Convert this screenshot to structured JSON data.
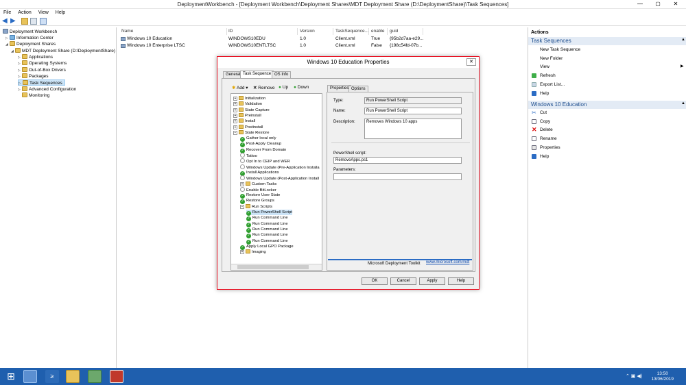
{
  "window": {
    "title": "DeploymentWorkbench - [Deployment Workbench\\Deployment Shares\\MDT Deployment Share (D:\\DeploymentShare)\\Task Sequences]",
    "minimize": "—",
    "maximize": "▢",
    "close": "✕"
  },
  "menu": [
    "File",
    "Action",
    "View",
    "Help"
  ],
  "tree": {
    "items": [
      {
        "label": "Deployment Workbench"
      },
      {
        "label": "Information Center"
      },
      {
        "label": "Deployment Shares"
      },
      {
        "label": "MDT Deployment Share (D:\\DeploymentShare)"
      },
      {
        "label": "Applications"
      },
      {
        "label": "Operating Systems"
      },
      {
        "label": "Out-of-Box Drivers"
      },
      {
        "label": "Packages"
      },
      {
        "label": "Task Sequences"
      },
      {
        "label": "Advanced Configuration"
      },
      {
        "label": "Monitoring"
      }
    ]
  },
  "list": {
    "columns": [
      "Name",
      "ID",
      "Version",
      "TaskSequence...",
      "enable",
      "guid"
    ],
    "rows": [
      [
        "Windows 10 Education",
        "WINDOWS10EDU",
        "1.0",
        "Client.xml",
        "True",
        "{95b2d7aa-e29..."
      ],
      [
        "Windows 10 Enterprise LTSC",
        "WINDOWS10ENTLTSC",
        "1.0",
        "Client.xml",
        "False",
        "{198c54fd-07b..."
      ]
    ]
  },
  "actions": {
    "header": "Actions",
    "section1": {
      "title": "Task Sequences",
      "items": [
        "New Task Sequence",
        "New Folder",
        "View",
        "Refresh",
        "Export List...",
        "Help"
      ]
    },
    "section2": {
      "title": "Windows 10 Education",
      "items": [
        "Cut",
        "Copy",
        "Delete",
        "Rename",
        "Properties",
        "Help"
      ]
    }
  },
  "dialog": {
    "title": "Windows 10 Education Properties",
    "tabs": [
      "General",
      "Task Sequence",
      "OS Info"
    ],
    "toolbar": {
      "add": "Add",
      "remove": "Remove",
      "up": "Up",
      "down": "Down"
    },
    "steps": [
      {
        "label": "Initialization",
        "kind": "group",
        "level": 0
      },
      {
        "label": "Validation",
        "kind": "group",
        "level": 0
      },
      {
        "label": "State Capture",
        "kind": "group",
        "level": 0
      },
      {
        "label": "Preinstall",
        "kind": "group",
        "level": 0
      },
      {
        "label": "Install",
        "kind": "group",
        "level": 0
      },
      {
        "label": "Postinstall",
        "kind": "group",
        "level": 0
      },
      {
        "label": "State Restore",
        "kind": "group",
        "level": 0
      },
      {
        "label": "Gather local only",
        "kind": "ok",
        "level": 1
      },
      {
        "label": "Post-Apply Cleanup",
        "kind": "ok",
        "level": 1
      },
      {
        "label": "Recover From Domain",
        "kind": "ok",
        "level": 1
      },
      {
        "label": "Tattoo",
        "kind": "dis",
        "level": 1
      },
      {
        "label": "Opt In to CEIP and WER",
        "kind": "dis",
        "level": 1
      },
      {
        "label": "Windows Update (Pre-Application Installa",
        "kind": "dis",
        "level": 1
      },
      {
        "label": "Install Applications",
        "kind": "ok",
        "level": 1
      },
      {
        "label": "Windows Update (Post-Application Install",
        "kind": "dis",
        "level": 1
      },
      {
        "label": "Custom Tasks",
        "kind": "group",
        "level": 1
      },
      {
        "label": "Enable BitLocker",
        "kind": "dis",
        "level": 1
      },
      {
        "label": "Restore User State",
        "kind": "ok",
        "level": 1
      },
      {
        "label": "Restore Groups",
        "kind": "ok",
        "level": 1
      },
      {
        "label": "Run Scripts",
        "kind": "group",
        "level": 1
      },
      {
        "label": "Run PowerShell Script",
        "kind": "ok",
        "level": 2
      },
      {
        "label": "Run Command Line",
        "kind": "ok",
        "level": 2
      },
      {
        "label": "Run Command Line",
        "kind": "ok",
        "level": 2
      },
      {
        "label": "Run Command Line",
        "kind": "ok",
        "level": 2
      },
      {
        "label": "Run Command Line",
        "kind": "ok",
        "level": 2
      },
      {
        "label": "Run Command Line",
        "kind": "ok",
        "level": 2
      },
      {
        "label": "Apply Local GPO Package",
        "kind": "ok",
        "level": 1
      },
      {
        "label": "Imaging",
        "kind": "group",
        "level": 1
      }
    ],
    "subtabs": [
      "Properties",
      "Options"
    ],
    "fields": {
      "type_label": "Type:",
      "type_value": "Run PowerShell Script",
      "name_label": "Name:",
      "name_value": "Run PowerShell Script",
      "desc_label": "Description:",
      "desc_value": "Removes Windows 10 apps",
      "script_label": "PowerShell script:",
      "script_value": "RemoveApps.ps1",
      "params_label": "Parameters:",
      "params_value": ""
    },
    "footer_text": "Microsoft Deployment Toolkit",
    "footer_link": "www.microsoft.com/mdt",
    "buttons": {
      "ok": "OK",
      "cancel": "Cancel",
      "apply": "Apply",
      "help": "Help"
    }
  },
  "taskbar": {
    "time": "13:50",
    "date": "13/06/2019"
  }
}
